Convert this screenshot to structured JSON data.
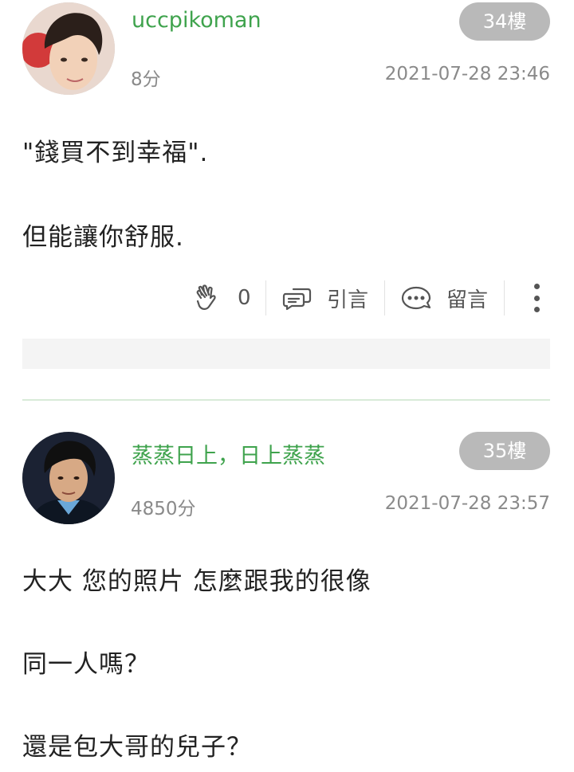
{
  "posts": [
    {
      "username": "uccpikoman",
      "score": "8分",
      "floor": "34樓",
      "timestamp": "2021-07-28 23:46",
      "lines": [
        "\"錢買不到幸福\".",
        "但能讓你舒服."
      ]
    },
    {
      "username": "蒸蒸日上，日上蒸蒸",
      "score": "4850分",
      "floor": "35樓",
      "timestamp": "2021-07-28 23:57",
      "lines": [
        "大大 您的照片 怎麼跟我的很像",
        "同一人嗎？",
        "還是包大哥的兒子？"
      ]
    }
  ],
  "actions": {
    "like_count": "0",
    "quote_label": "引言",
    "comment_label": "留言"
  },
  "colors": {
    "username": "#3fa34d",
    "floor_badge": "#b9b9b9",
    "meta_text": "#8a8a8a"
  }
}
